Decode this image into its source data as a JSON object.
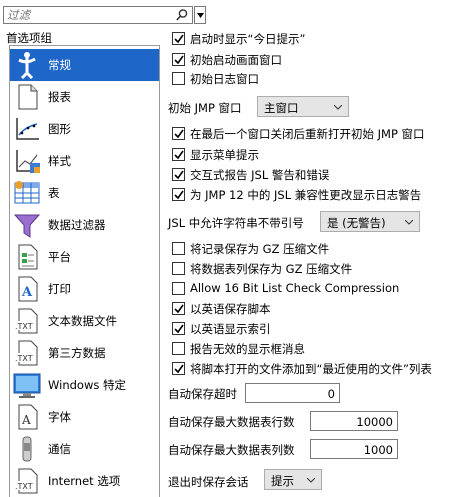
{
  "filter": {
    "placeholder": "过滤"
  },
  "group_label": "首选项组",
  "sidebar": {
    "items": [
      {
        "label": "常规",
        "icon": "general-icon"
      },
      {
        "label": "报表",
        "icon": "report-icon"
      },
      {
        "label": "图形",
        "icon": "graph-icon"
      },
      {
        "label": "样式",
        "icon": "style-icon"
      },
      {
        "label": "表",
        "icon": "table-icon"
      },
      {
        "label": "数据过滤器",
        "icon": "data-filter-icon"
      },
      {
        "label": "平台",
        "icon": "platform-icon"
      },
      {
        "label": "打印",
        "icon": "print-icon"
      },
      {
        "label": "文本数据文件",
        "icon": "text-data-file-icon"
      },
      {
        "label": "第三方数据",
        "icon": "third-party-data-icon"
      },
      {
        "label": "Windows 特定",
        "icon": "windows-icon"
      },
      {
        "label": "字体",
        "icon": "font-icon"
      },
      {
        "label": "通信",
        "icon": "communication-icon"
      },
      {
        "label": "Internet 选项",
        "icon": "internet-options-icon"
      }
    ]
  },
  "options": {
    "show_tip": {
      "label": "启动时显示“今日提示”",
      "checked": true
    },
    "initial_splash": {
      "label": "初始启动画面窗口",
      "checked": true
    },
    "initial_log": {
      "label": "初始日志窗口",
      "checked": false
    },
    "initial_jmp_window": {
      "label": "初始 JMP 窗口",
      "value": "主窗口"
    },
    "reopen_initial": {
      "label": "在最后一个窗口关闭后重新打开初始 JMP 窗口",
      "checked": true
    },
    "show_menu_tips": {
      "label": "显示菜单提示",
      "checked": true
    },
    "interactive_jsl": {
      "label": "交互式报告 JSL 警告和错误",
      "checked": true
    },
    "jmp12_compat": {
      "label": "为 JMP 12 中的 JSL 兼容性更改显示日志警告",
      "checked": true
    },
    "jsl_unquoted": {
      "label": "JSL 中允许字符串不带引号",
      "value": "是 (无警告)"
    },
    "gz_log": {
      "label": "将记录保存为 GZ 压缩文件",
      "checked": false
    },
    "gz_table": {
      "label": "将数据表列保存为 GZ 压缩文件",
      "checked": false
    },
    "bit16": {
      "label": "Allow 16 Bit List Check Compression",
      "checked": false
    },
    "save_script_english": {
      "label": "以英语保存脚本",
      "checked": true
    },
    "show_index_english": {
      "label": "以英语显示索引",
      "checked": true
    },
    "report_invalid_box": {
      "label": "报告无效的显示框消息",
      "checked": false
    },
    "recent_files": {
      "label": "将脚本打开的文件添加到“最近使用的文件”列表",
      "checked": true
    },
    "autosave_timeout": {
      "label": "自动保存超时",
      "value": "0"
    },
    "autosave_max_rows": {
      "label": "自动保存最大数据表行数",
      "value": "10000"
    },
    "autosave_max_cols": {
      "label": "自动保存最大数据表列数",
      "value": "1000"
    },
    "exit_save_session": {
      "label": "退出时保存会话",
      "value": "提示"
    }
  }
}
